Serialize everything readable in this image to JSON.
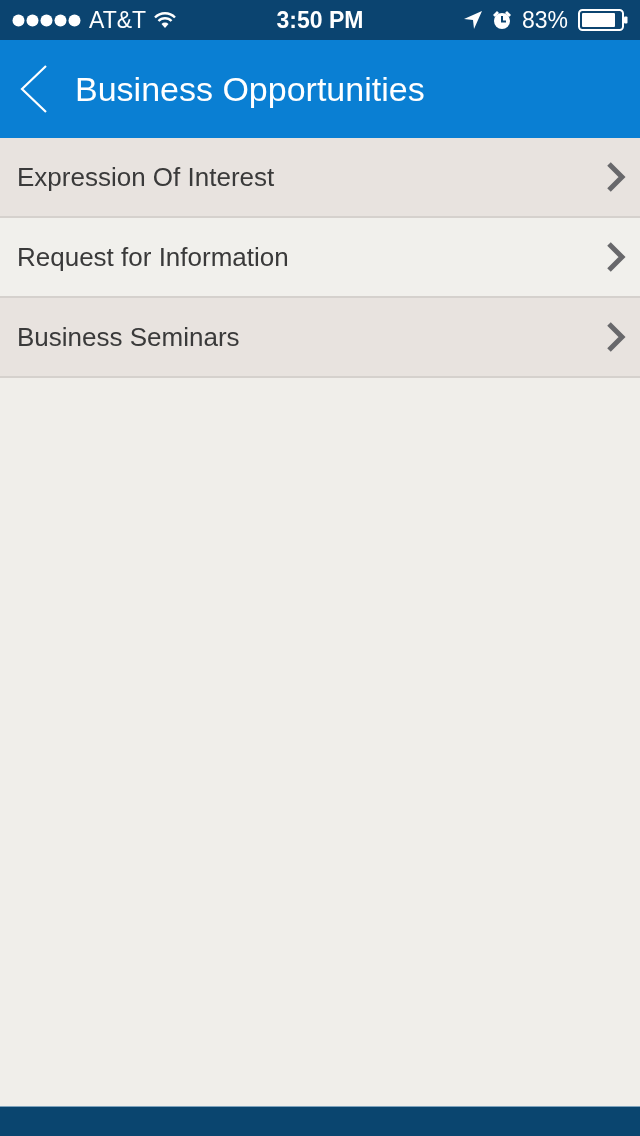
{
  "status_bar": {
    "carrier": "AT&T",
    "time": "3:50 PM",
    "battery": "83%"
  },
  "header": {
    "title": "Business Opportunities"
  },
  "menu_items": [
    {
      "label": "Expression Of Interest"
    },
    {
      "label": "Request for Information"
    },
    {
      "label": "Business Seminars"
    }
  ]
}
